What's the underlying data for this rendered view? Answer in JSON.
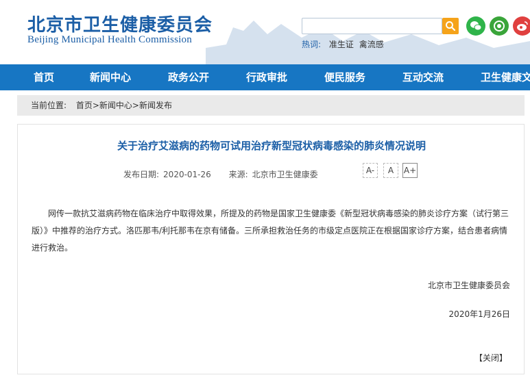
{
  "site": {
    "name_cn": "北京市卫生健康委员会",
    "name_en": "Beijing Municipal Health Commission"
  },
  "search": {
    "placeholder": "",
    "hot_label": "热词:",
    "hot_items": [
      "准生证",
      "禽流感"
    ]
  },
  "social": [
    "wechat-icon",
    "app-icon",
    "weibo-icon"
  ],
  "nav": {
    "items": [
      "首页",
      "新闻中心",
      "政务公开",
      "行政审批",
      "便民服务",
      "互动交流",
      "卫生健康文"
    ]
  },
  "breadcrumb": {
    "label": "当前位置:",
    "path": "首页>新闻中心>新闻发布"
  },
  "article": {
    "title": "关于治疗艾滋病的药物可试用治疗新型冠状病毒感染的肺炎情况说明",
    "publish_label": "发布日期:",
    "publish_date": "2020-01-26",
    "source_label": "来源:",
    "source": "北京市卫生健康委",
    "font_buttons": [
      "A-",
      "A",
      "A+"
    ],
    "body": "网传一款抗艾滋病药物在临床治疗中取得效果，所提及的药物是国家卫生健康委《新型冠状病毒感染的肺炎诊疗方案（试行第三版）》中推荐的治疗方式。洛匹那韦/利托那韦在京有储备。三所承担救治任务的市级定点医院正在根据国家诊疗方案，结合患者病情进行救治。",
    "signature": "北京市卫生健康委员会",
    "sign_date": "2020年1月26日",
    "close": "【关闭】"
  },
  "colors": {
    "brand_blue": "#1b5ea6",
    "nav_blue": "#1776c3",
    "search_orange": "#f5a31a"
  }
}
